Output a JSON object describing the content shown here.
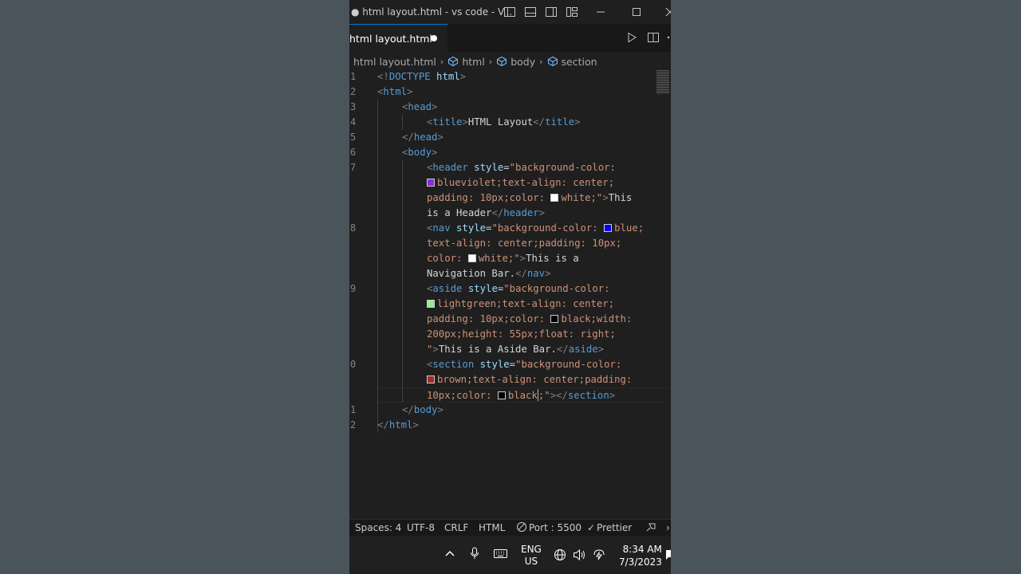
{
  "window": {
    "title": "● html layout.html - vs code - V..."
  },
  "tab": {
    "label": "html layout.html"
  },
  "breadcrumb": {
    "file": "html layout.html",
    "items": [
      "html",
      "body",
      "section"
    ]
  },
  "gutter": [
    "1",
    "2",
    "3",
    "4",
    "5",
    "6",
    "7",
    "8",
    "9",
    "0",
    "1",
    "2"
  ],
  "code": {
    "l1a": "<!",
    "l1b": "DOCTYPE",
    "l1c": " html",
    "l1d": ">",
    "l2a": "<",
    "l2b": "html",
    "l2c": ">",
    "l3a": "<",
    "l3b": "head",
    "l3c": ">",
    "l4a": "<",
    "l4b": "title",
    "l4c": ">",
    "l4d": "HTML Layout",
    "l4e": "</",
    "l4f": "title",
    "l4g": ">",
    "l5a": "</",
    "l5b": "head",
    "l5c": ">",
    "l6a": "<",
    "l6b": "body",
    "l6c": ">",
    "h1a": "<",
    "h1b": "header",
    "h1c": " style",
    "h1d": "=",
    "h1e": "\"background-color:",
    "h2": "blueviolet;text-align: center;",
    "h3a": "padding: 10px;color: ",
    "h3b": "white;\"",
    "h3c": ">",
    "h3d": "This",
    "h4a": "is a Header",
    "h4b": "</",
    "h4c": "header",
    "h4d": ">",
    "n1a": "<",
    "n1b": "nav",
    "n1c": " style",
    "n1d": "=",
    "n1e": "\"background-color: ",
    "n1f": "blue;",
    "n2": "text-align: center;padding: 10px;",
    "n3a": "color: ",
    "n3b": "white;\"",
    "n3c": ">",
    "n3d": "This is a",
    "n4a": "Navigation Bar.",
    "n4b": "</",
    "n4c": "nav",
    "n4d": ">",
    "a1a": "<",
    "a1b": "aside",
    "a1c": " style",
    "a1d": "=",
    "a1e": "\"background-color:",
    "a2": "lightgreen;text-align: center;",
    "a3a": "padding: 10px;color: ",
    "a3b": "black;width:",
    "a4": "200px;height: 55px;float: right;",
    "a5a": "\"",
    "a5b": ">",
    "a5c": "This is a Aside Bar.",
    "a5d": "</",
    "a5e": "aside",
    "a5f": ">",
    "s1a": "<",
    "s1b": "section",
    "s1c": " style",
    "s1d": "=",
    "s1e": "\"background-color:",
    "s2": "brown;text-align: center;padding:",
    "s3a": "10px;color: ",
    "s3b": "black",
    "s3c": ";\"",
    "s3d": "></",
    "s3e": "section",
    "s3f": ">",
    "l11a": "</",
    "l11b": "body",
    "l11c": ">",
    "l12a": "</",
    "l12b": "html",
    "l12c": ">"
  },
  "swatches": {
    "blueviolet": "#8a2be2",
    "white": "#ffffff",
    "blue": "#0000ff",
    "lightgreen": "#90ee90",
    "black": "#000000",
    "brown": "#a52a2a"
  },
  "statusbar": {
    "spaces": "Spaces: 4",
    "encoding": "UTF-8",
    "eol": "CRLF",
    "language": "HTML",
    "port": "Port : 5500",
    "prettier": "Prettier"
  },
  "taskbar": {
    "lang1": "ENG",
    "lang2": "US",
    "time": "8:34 AM",
    "date": "7/3/2023"
  },
  "colors": {
    "accent": "#0078d4",
    "editor_bg": "#1f1f1f",
    "tag": "#569cd6",
    "attribute": "#9cdcfe",
    "string": "#ce9178"
  }
}
